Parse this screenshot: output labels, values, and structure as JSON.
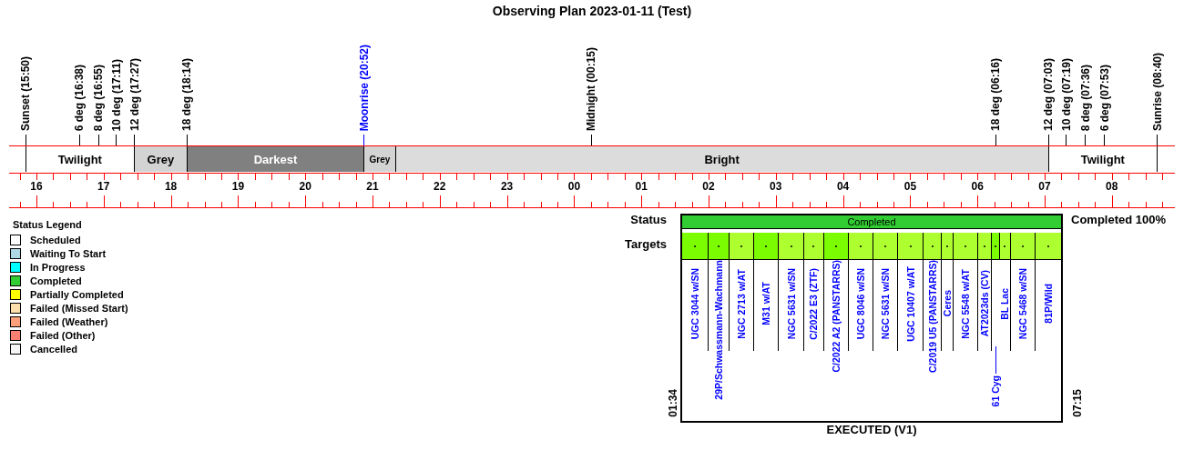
{
  "title": "Observing Plan 2023-01-11 (Test)",
  "events": [
    {
      "label": "Sunset (15:50)",
      "kind": "sun"
    },
    {
      "label": "6 deg (16:38)",
      "kind": "twilight"
    },
    {
      "label": "8 deg (16:55)",
      "kind": "twilight"
    },
    {
      "label": "10 deg (17:11)",
      "kind": "twilight"
    },
    {
      "label": "12 deg (17:27)",
      "kind": "twilight"
    },
    {
      "label": "18 deg (18:14)",
      "kind": "twilight"
    },
    {
      "label": "Moonrise (20:52)",
      "kind": "moon"
    },
    {
      "label": "Midnight (00:15)",
      "kind": "midnight"
    },
    {
      "label": "18 deg (06:16)",
      "kind": "twilight"
    },
    {
      "label": "12 deg (07:03)",
      "kind": "twilight"
    },
    {
      "label": "10 deg (07:19)",
      "kind": "twilight"
    },
    {
      "label": "8 deg (07:36)",
      "kind": "twilight"
    },
    {
      "label": "6 deg (07:53)",
      "kind": "twilight"
    },
    {
      "label": "Sunrise (08:40)",
      "kind": "sun"
    }
  ],
  "bands": [
    {
      "label": "Twilight",
      "kind": "twilight"
    },
    {
      "label": "Grey",
      "kind": "grey"
    },
    {
      "label": "Darkest",
      "kind": "darkest"
    },
    {
      "label": "Grey",
      "kind": "grey"
    },
    {
      "label": "Bright",
      "kind": "bright"
    },
    {
      "label": "Twilight",
      "kind": "twilight"
    }
  ],
  "hours": [
    "16",
    "17",
    "18",
    "19",
    "20",
    "21",
    "22",
    "23",
    "00",
    "01",
    "02",
    "03",
    "04",
    "05",
    "06",
    "07",
    "08"
  ],
  "legend": {
    "title": "Status Legend",
    "items": [
      {
        "label": "Scheduled",
        "color": "#ffffff"
      },
      {
        "label": "Waiting To Start",
        "color": "#add8e6"
      },
      {
        "label": "In Progress",
        "color": "#00ffff"
      },
      {
        "label": "Completed",
        "color": "#32cd32"
      },
      {
        "label": "Partially Completed",
        "color": "#ffff00"
      },
      {
        "label": "Failed (Missed Start)",
        "color": "#ffdead"
      },
      {
        "label": "Failed (Weather)",
        "color": "#ffa07a"
      },
      {
        "label": "Failed (Other)",
        "color": "#fa8072"
      },
      {
        "label": "Cancelled",
        "color": "#f5f5f5"
      }
    ]
  },
  "executed": {
    "status_label": "Status",
    "targets_label": "Targets",
    "status": {
      "label": "Completed",
      "color": "#32cd32"
    },
    "completion": "Completed 100%",
    "start": "01:34",
    "end": "07:15",
    "footer": "EXECUTED (V1)",
    "targets": [
      {
        "name": "UGC 3044 w/SN",
        "color": "#7cfc00",
        "leader": false
      },
      {
        "name": "29P/Schwassmann-Wachmann",
        "color": "#7cfc00",
        "leader": false
      },
      {
        "name": "NGC 2713 w/AT",
        "color": "#adff2f",
        "leader": false
      },
      {
        "name": "M31 w/AT",
        "color": "#7cfc00",
        "leader": false
      },
      {
        "name": "NGC 5631 w/SN",
        "color": "#adff2f",
        "leader": false
      },
      {
        "name": "C/2022 E3 (ZTF)",
        "color": "#adff2f",
        "leader": false
      },
      {
        "name": "C/2022 A2 (PANSTARRS)",
        "color": "#7cfc00",
        "leader": false
      },
      {
        "name": "UGC 8046 w/SN",
        "color": "#adff2f",
        "leader": false
      },
      {
        "name": "NGC 5631 w/SN",
        "color": "#adff2f",
        "leader": false
      },
      {
        "name": "UGC 10407 w/AT",
        "color": "#adff2f",
        "leader": false
      },
      {
        "name": "C/2019 U5 (PANSTARRS)",
        "color": "#adff2f",
        "leader": false
      },
      {
        "name": "Ceres",
        "color": "#adff2f",
        "leader": false
      },
      {
        "name": "NGC 5548 w/AT",
        "color": "#adff2f",
        "leader": false
      },
      {
        "name": "AT2023ds (CV)",
        "color": "#adff2f",
        "leader": false
      },
      {
        "name": "61 Cyg",
        "color": "#7cfc00",
        "leader": true
      },
      {
        "name": "BL Lac",
        "color": "#adff2f",
        "leader": false
      },
      {
        "name": "NGC 5468 w/SN",
        "color": "#adff2f",
        "leader": false
      },
      {
        "name": "81P/Wild",
        "color": "#adff2f",
        "leader": false
      }
    ]
  }
}
